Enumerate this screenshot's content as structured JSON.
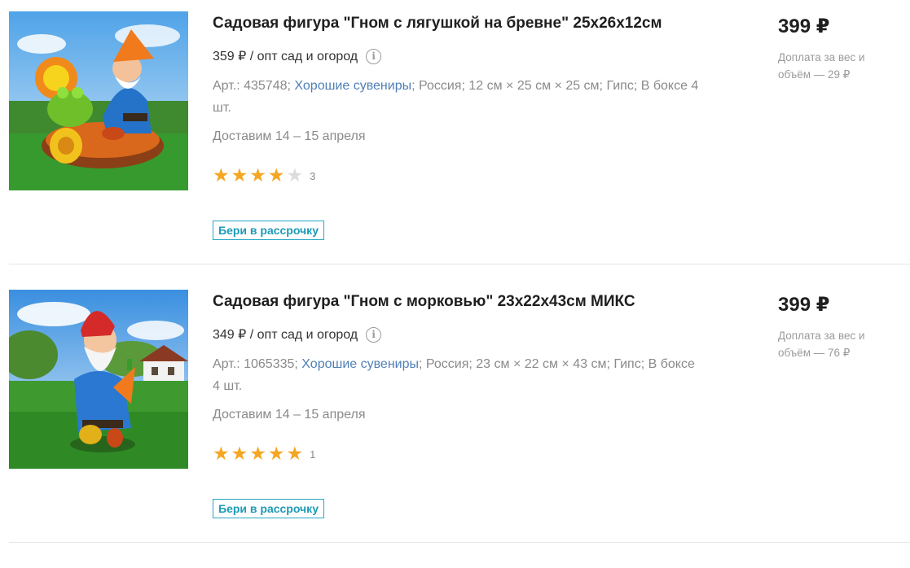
{
  "products": [
    {
      "title": "Садовая фигура \"Гном с лягушкой на бревне\" 25х26х12см",
      "wholesale_price": "359 ₽ / опт сад и огород",
      "specs_prefix": "Арт.: 435748;",
      "brand": "Хорошие сувениры",
      "specs_suffix": "; Россия; 12 см × 25 см × 25 см; Гипс; В боксе 4 шт.",
      "delivery": "Доставим 14 – 15 апреля",
      "rating": 4,
      "reviews": "3",
      "installment": "Бери в рассрочку",
      "price": "399 ₽",
      "surcharge": "Доплата за вес и объём — 29 ₽",
      "image_icon": "garden-gnome-with-frog-image"
    },
    {
      "title": "Садовая фигура \"Гном с морковью\" 23х22х43см МИКС",
      "wholesale_price": "349 ₽ / опт сад и огород",
      "specs_prefix": "Арт.: 1065335;",
      "brand": "Хорошие сувениры",
      "specs_suffix": "; Россия; 23 см × 22 см × 43 см; Гипс; В боксе 4 шт.",
      "delivery": "Доставим 14 – 15 апреля",
      "rating": 5,
      "reviews": "1",
      "installment": "Бери в рассрочку",
      "price": "399 ₽",
      "surcharge": "Доплата за вес и объём — 76 ₽",
      "image_icon": "garden-gnome-with-carrot-image"
    }
  ],
  "info_icon_glyph": "i",
  "colors": {
    "star_on": "#f5a623",
    "star_off": "#dcdcdc",
    "brand_link": "#4f7fb6",
    "installment": "#1d9ab7"
  }
}
